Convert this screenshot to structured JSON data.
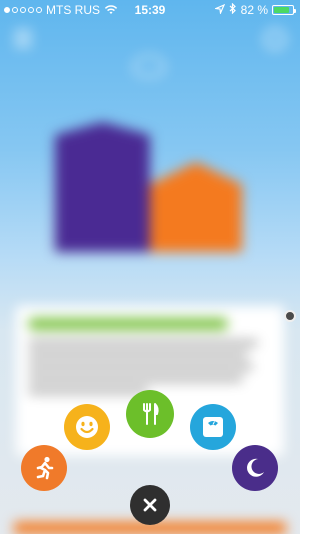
{
  "status_bar": {
    "carrier": "MTS RUS",
    "time": "15:39",
    "battery_percent": "82 %",
    "signal_dots_filled": 1,
    "signal_dots_total": 5,
    "battery_level": 0.82,
    "icons": [
      "signal-dots-icon",
      "wifi-icon",
      "location-arrow-icon",
      "bluetooth-icon",
      "battery-icon"
    ]
  },
  "quick_add_menu": {
    "buttons": [
      {
        "name": "activity",
        "icon": "running-person-icon",
        "color": "#f07a2a"
      },
      {
        "name": "mood",
        "icon": "smiley-face-icon",
        "color": "#f6b21b"
      },
      {
        "name": "food",
        "icon": "fork-knife-icon",
        "color": "#6cbf2a"
      },
      {
        "name": "weight",
        "icon": "scale-icon",
        "color": "#25a6dc"
      },
      {
        "name": "sleep",
        "icon": "moon-icon",
        "color": "#4a2d8a"
      },
      {
        "name": "close",
        "icon": "close-icon",
        "color": "#2f2f2f"
      }
    ]
  }
}
